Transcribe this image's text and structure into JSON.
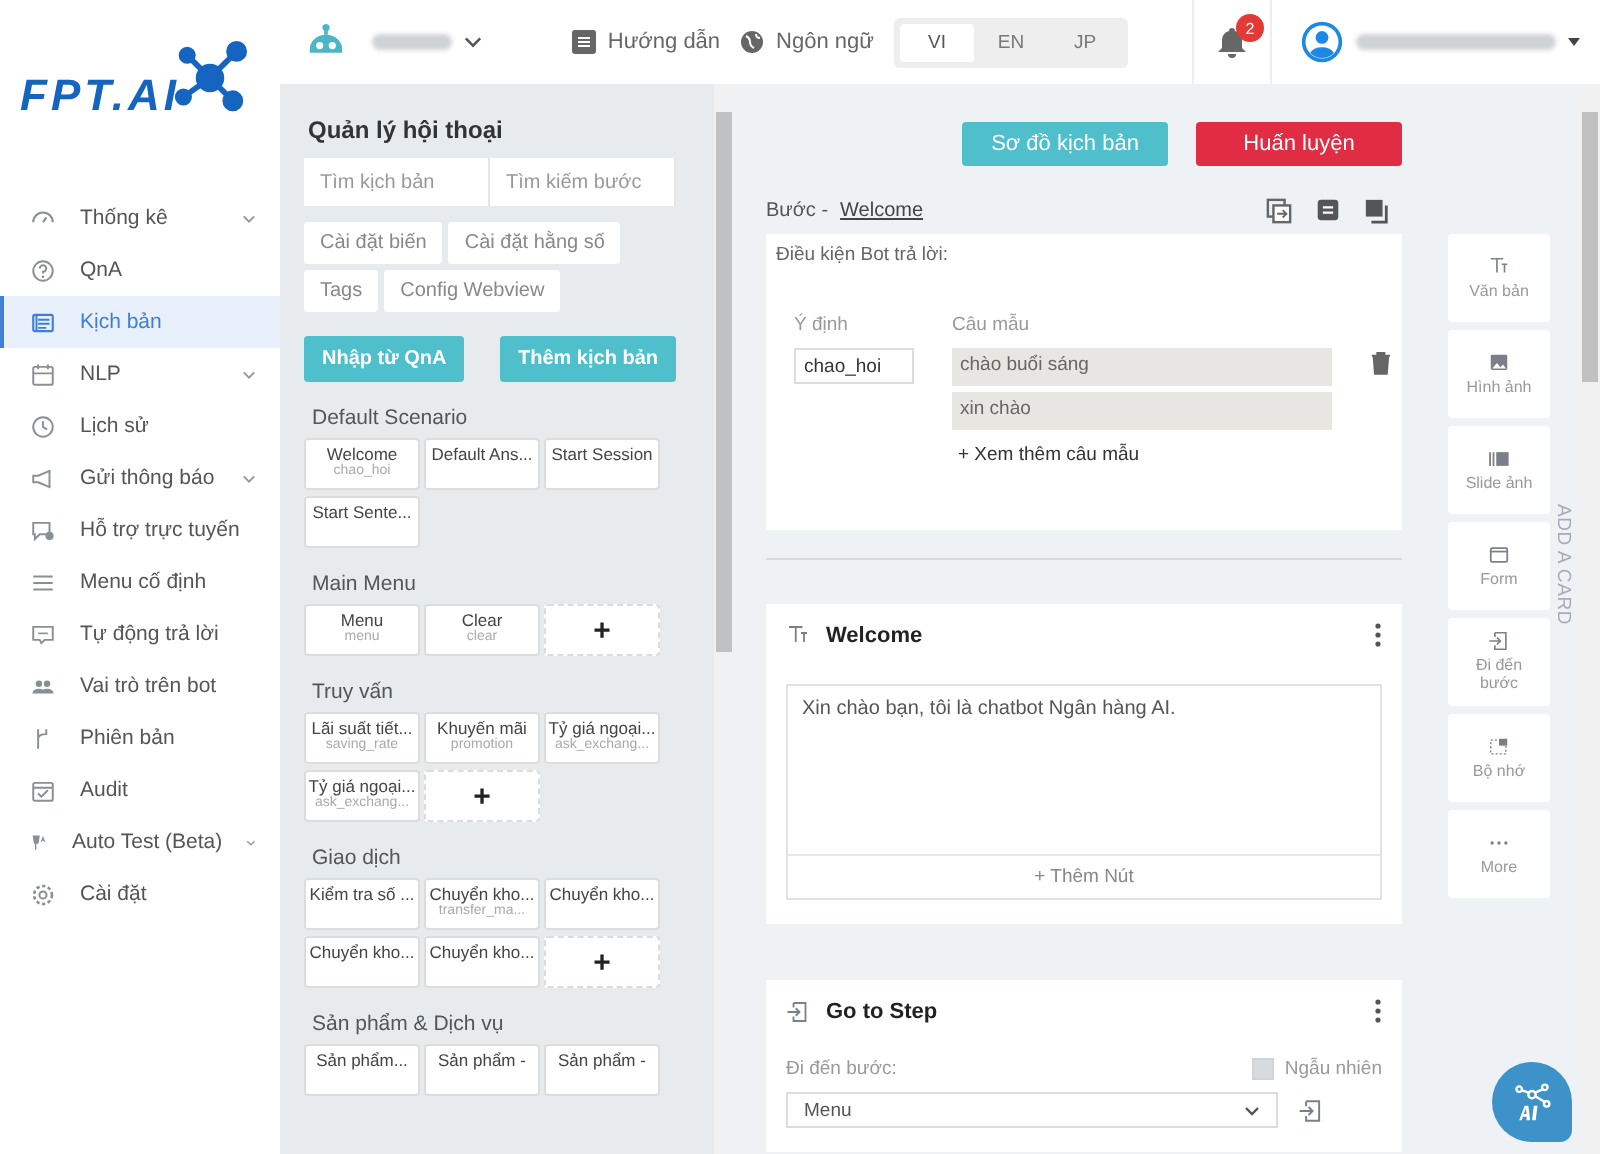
{
  "logo": {
    "text": "FPT.AI"
  },
  "sidebar": {
    "items": [
      {
        "label": "Thống kê",
        "expandable": true,
        "selected": false
      },
      {
        "label": "QnA",
        "expandable": false,
        "selected": false
      },
      {
        "label": "Kịch bản",
        "expandable": false,
        "selected": true
      },
      {
        "label": "NLP",
        "expandable": true,
        "selected": false
      },
      {
        "label": "Lịch sử",
        "expandable": false,
        "selected": false
      },
      {
        "label": "Gửi thông báo",
        "expandable": true,
        "selected": false
      },
      {
        "label": "Hỗ trợ trực tuyến",
        "expandable": false,
        "selected": false
      },
      {
        "label": "Menu cố định",
        "expandable": false,
        "selected": false
      },
      {
        "label": "Tự động trả lời",
        "expandable": false,
        "selected": false
      },
      {
        "label": "Vai trò trên bot",
        "expandable": false,
        "selected": false
      },
      {
        "label": "Phiên bản",
        "expandable": false,
        "selected": false
      },
      {
        "label": "Audit",
        "expandable": false,
        "selected": false
      },
      {
        "label": "Auto Test (Beta)",
        "expandable": true,
        "selected": false
      },
      {
        "label": "Cài đặt",
        "expandable": false,
        "selected": false
      }
    ]
  },
  "topbar": {
    "guide": "Hướng dẫn",
    "language_label": "Ngôn ngữ",
    "languages": [
      {
        "label": "VI",
        "selected": true
      },
      {
        "label": "EN",
        "selected": false
      },
      {
        "label": "JP",
        "selected": false
      }
    ],
    "notification_count": "2"
  },
  "scenarios": {
    "title": "Quản lý hội thoại",
    "search_fields": [
      {
        "placeholder": "Tìm kịch bản"
      },
      {
        "placeholder": "Tìm kiếm bước"
      }
    ],
    "setting_buttons": [
      [
        "Cài đặt biến",
        "Cài đặt hằng số"
      ],
      [
        "Tags",
        "Config Webview"
      ]
    ],
    "actions": [
      "Nhập từ QnA",
      "Thêm kịch bản"
    ],
    "groups": [
      {
        "title": "Default Scenario",
        "cards": [
          {
            "name": "Welcome",
            "intent": "chao_hoi"
          },
          {
            "name": "Default Ans..."
          },
          {
            "name": "Start Session"
          },
          {
            "name": "Start Sente..."
          }
        ]
      },
      {
        "title": "Main Menu",
        "cards": [
          {
            "name": "Menu",
            "intent": "menu"
          },
          {
            "name": "Clear",
            "intent": "clear"
          }
        ],
        "add_card": "+"
      },
      {
        "title": "Truy vấn",
        "cards": [
          {
            "name": "Lãi suất tiết...",
            "intent": "saving_rate"
          },
          {
            "name": "Khuyến mãi",
            "intent": "promotion"
          },
          {
            "name": "Tỷ giá ngoại...",
            "intent": "ask_exchang..."
          },
          {
            "name": "Tỷ giá ngoại...",
            "intent": "ask_exchang..."
          }
        ],
        "add_card": "+"
      },
      {
        "title": "Giao dịch",
        "cards": [
          {
            "name": "Kiểm tra số ..."
          },
          {
            "name": "Chuyển kho...",
            "intent": "transfer_ma..."
          },
          {
            "name": "Chuyển kho..."
          },
          {
            "name": "Chuyển kho..."
          },
          {
            "name": "Chuyển kho..."
          }
        ],
        "add_card": "+"
      },
      {
        "title": "Sản phẩm & Dịch vụ",
        "cards": [
          {
            "name": "Sản phẩm..."
          },
          {
            "name": "Sản phẩm -"
          },
          {
            "name": "Sản phẩm -"
          }
        ]
      }
    ]
  },
  "editor": {
    "buttons": [
      {
        "label": "Sơ đồ kịch bản",
        "kind": "primary"
      },
      {
        "label": "Huấn luyện",
        "kind": "danger"
      }
    ],
    "step_prefix": "Bước -",
    "step_name": "Welcome",
    "condition": {
      "title": "Điều kiện Bot trả lời:",
      "intent_label": "Ý định",
      "intent": "chao_hoi",
      "samples_label": "Câu mẫu",
      "samples": [
        "chào buổi sáng",
        "xin chào"
      ],
      "more": "+ Xem thêm câu mẫu"
    },
    "cards": [
      {
        "kind": "text",
        "title": "Welcome",
        "text": "Xin chào bạn, tôi là chatbot Ngân hàng AI.",
        "add_button": "+ Thêm Nút"
      },
      {
        "kind": "goto",
        "title": "Go to Step",
        "label": "Đi đến bước:",
        "random": {
          "label": "Ngẫu nhiên",
          "checked": false
        },
        "value": "Menu"
      }
    ]
  },
  "add_card": {
    "title": "ADD A CARD",
    "items": [
      {
        "label": "Văn bản"
      },
      {
        "label": "Hình ảnh"
      },
      {
        "label": "Slide ảnh"
      },
      {
        "label": "Form"
      },
      {
        "label": "Đi đến bước"
      },
      {
        "label": "Bộ nhớ"
      },
      {
        "label": "More"
      }
    ]
  }
}
